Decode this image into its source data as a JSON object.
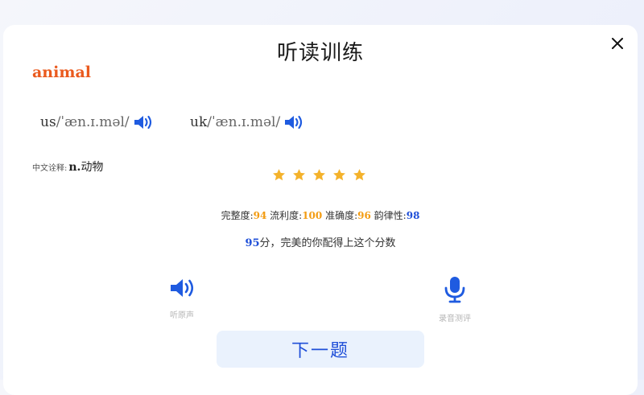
{
  "dialog": {
    "title": "听读训练",
    "close_icon": "close-icon"
  },
  "word": {
    "text": "animal",
    "color": "#ea5a1e"
  },
  "pronunciations": [
    {
      "region": "us",
      "phonetic": "/ˈæn.ɪ.məl/",
      "icon": "speaker-icon"
    },
    {
      "region": "uk",
      "phonetic": "/ˈæn.ɪ.məl/",
      "icon": "speaker-icon"
    }
  ],
  "meaning": {
    "label": "中文诠释:",
    "pos": "n.",
    "text": "动物"
  },
  "rating": {
    "stars": 5,
    "max": 5,
    "color": "#f4b22b"
  },
  "scores": [
    {
      "label": "完整度:",
      "value": "94",
      "color": "#f39c12"
    },
    {
      "label": "流利度:",
      "value": "100",
      "color": "#f39c12"
    },
    {
      "label": "准确度:",
      "value": "96",
      "color": "#f39c12"
    },
    {
      "label": "韵律性:",
      "value": "98",
      "color": "#1f4fd8"
    }
  ],
  "summary": {
    "score": "95",
    "text": "分，完美的你配得上这个分数"
  },
  "tools": {
    "listen_label": "听原声",
    "record_label": "录音测评"
  },
  "next_button": "下一题",
  "accent_color": "#1f4fd8"
}
